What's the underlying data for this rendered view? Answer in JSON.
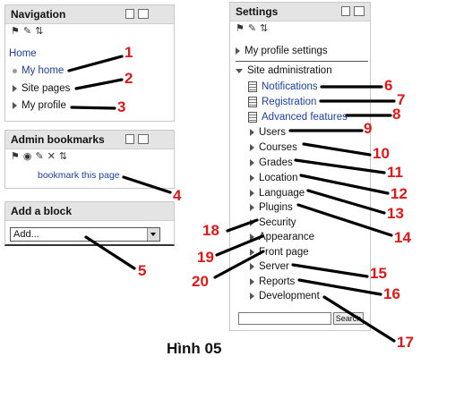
{
  "navigation": {
    "title": "Navigation",
    "home": "Home",
    "items": [
      "My home",
      "Site pages",
      "My profile"
    ]
  },
  "admin_bookmarks": {
    "title": "Admin bookmarks",
    "bookmark_link": "bookmark this page"
  },
  "add_block": {
    "title": "Add a block",
    "select_value": "Add..."
  },
  "settings": {
    "title": "Settings",
    "my_profile": "My profile settings",
    "site_admin": "Site administration",
    "items": [
      "Notifications",
      "Registration",
      "Advanced features",
      "Users",
      "Courses",
      "Grades",
      "Location",
      "Language",
      "Plugins",
      "Security",
      "Appearance",
      "Front page",
      "Server",
      "Reports",
      "Development"
    ],
    "search_button": "Search"
  },
  "annotations": [
    "1",
    "2",
    "3",
    "4",
    "5",
    "6",
    "7",
    "8",
    "9",
    "10",
    "11",
    "12",
    "13",
    "14",
    "15",
    "16",
    "17",
    "18",
    "19",
    "20"
  ],
  "caption": "Hình 05",
  "colors": {
    "link": "#1b3ea6",
    "annotation": "#e01818",
    "header": "#e4e4e4"
  }
}
